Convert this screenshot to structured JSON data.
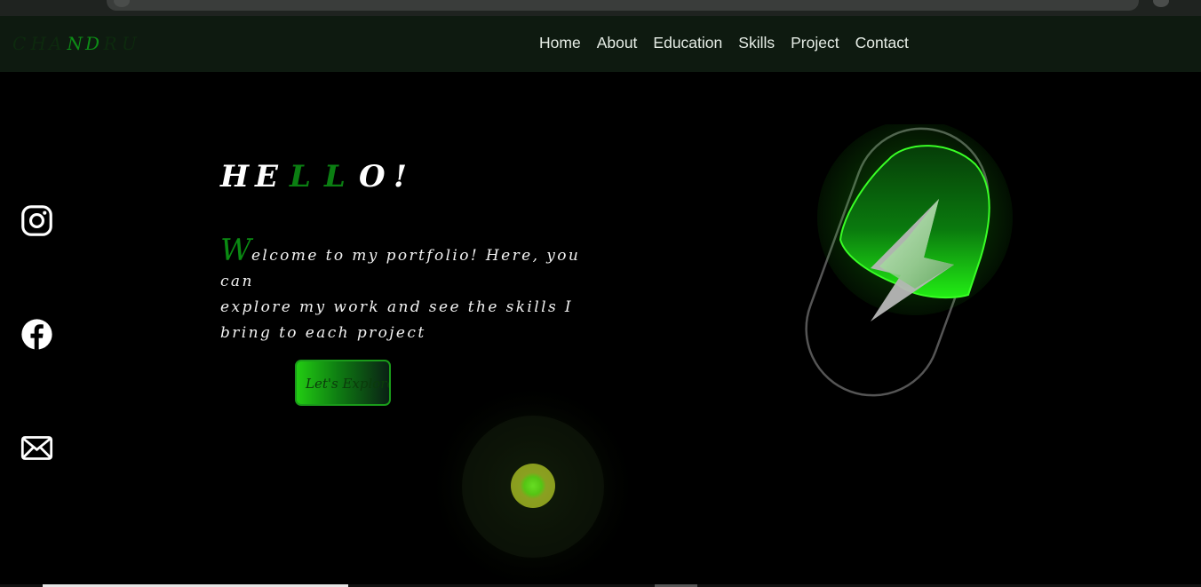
{
  "nav": {
    "logo_letters": [
      "C",
      "H",
      "A",
      "N",
      "D",
      "R",
      "U"
    ],
    "links": [
      "Home",
      "About",
      "Education",
      "Skills",
      "Project",
      "Contact"
    ]
  },
  "social": {
    "icons": [
      "instagram-icon",
      "facebook-icon",
      "mail-icon"
    ]
  },
  "hero": {
    "hello_letters": [
      "H",
      "E",
      "L",
      "L",
      "O",
      "!"
    ],
    "welcome_initial": "W",
    "welcome_line1": "elcome to my portfolio! Here, you can",
    "welcome_line2": "explore my work and see the skills I",
    "welcome_line3": "bring to each project",
    "cta_label": "Let's Explore"
  },
  "colors": {
    "accent_green": "#0a8a12",
    "bright_green": "#22cc12",
    "nav_bg": "#0e1a10",
    "background": "#000000"
  }
}
